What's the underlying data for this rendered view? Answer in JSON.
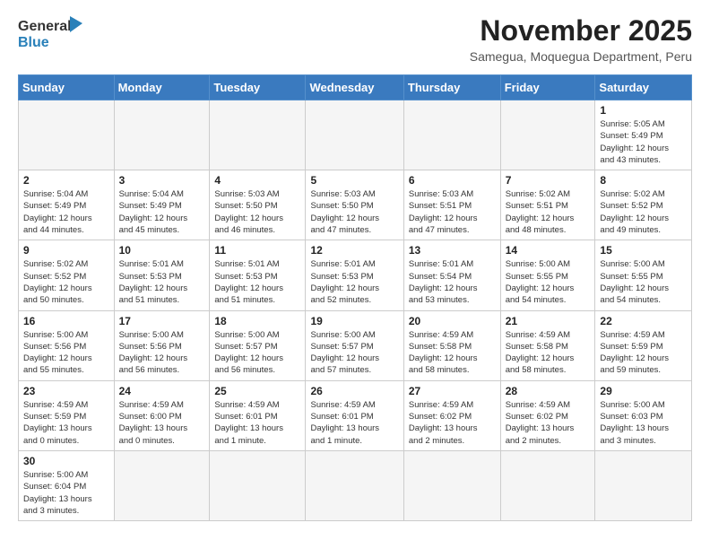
{
  "header": {
    "logo_general": "General",
    "logo_blue": "Blue",
    "month_year": "November 2025",
    "location": "Samegua, Moquegua Department, Peru"
  },
  "days_of_week": [
    "Sunday",
    "Monday",
    "Tuesday",
    "Wednesday",
    "Thursday",
    "Friday",
    "Saturday"
  ],
  "weeks": [
    [
      {
        "day": "",
        "info": ""
      },
      {
        "day": "",
        "info": ""
      },
      {
        "day": "",
        "info": ""
      },
      {
        "day": "",
        "info": ""
      },
      {
        "day": "",
        "info": ""
      },
      {
        "day": "",
        "info": ""
      },
      {
        "day": "1",
        "info": "Sunrise: 5:05 AM\nSunset: 5:49 PM\nDaylight: 12 hours\nand 43 minutes."
      }
    ],
    [
      {
        "day": "2",
        "info": "Sunrise: 5:04 AM\nSunset: 5:49 PM\nDaylight: 12 hours\nand 44 minutes."
      },
      {
        "day": "3",
        "info": "Sunrise: 5:04 AM\nSunset: 5:49 PM\nDaylight: 12 hours\nand 45 minutes."
      },
      {
        "day": "4",
        "info": "Sunrise: 5:03 AM\nSunset: 5:50 PM\nDaylight: 12 hours\nand 46 minutes."
      },
      {
        "day": "5",
        "info": "Sunrise: 5:03 AM\nSunset: 5:50 PM\nDaylight: 12 hours\nand 47 minutes."
      },
      {
        "day": "6",
        "info": "Sunrise: 5:03 AM\nSunset: 5:51 PM\nDaylight: 12 hours\nand 47 minutes."
      },
      {
        "day": "7",
        "info": "Sunrise: 5:02 AM\nSunset: 5:51 PM\nDaylight: 12 hours\nand 48 minutes."
      },
      {
        "day": "8",
        "info": "Sunrise: 5:02 AM\nSunset: 5:52 PM\nDaylight: 12 hours\nand 49 minutes."
      }
    ],
    [
      {
        "day": "9",
        "info": "Sunrise: 5:02 AM\nSunset: 5:52 PM\nDaylight: 12 hours\nand 50 minutes."
      },
      {
        "day": "10",
        "info": "Sunrise: 5:01 AM\nSunset: 5:53 PM\nDaylight: 12 hours\nand 51 minutes."
      },
      {
        "day": "11",
        "info": "Sunrise: 5:01 AM\nSunset: 5:53 PM\nDaylight: 12 hours\nand 51 minutes."
      },
      {
        "day": "12",
        "info": "Sunrise: 5:01 AM\nSunset: 5:53 PM\nDaylight: 12 hours\nand 52 minutes."
      },
      {
        "day": "13",
        "info": "Sunrise: 5:01 AM\nSunset: 5:54 PM\nDaylight: 12 hours\nand 53 minutes."
      },
      {
        "day": "14",
        "info": "Sunrise: 5:00 AM\nSunset: 5:55 PM\nDaylight: 12 hours\nand 54 minutes."
      },
      {
        "day": "15",
        "info": "Sunrise: 5:00 AM\nSunset: 5:55 PM\nDaylight: 12 hours\nand 54 minutes."
      }
    ],
    [
      {
        "day": "16",
        "info": "Sunrise: 5:00 AM\nSunset: 5:56 PM\nDaylight: 12 hours\nand 55 minutes."
      },
      {
        "day": "17",
        "info": "Sunrise: 5:00 AM\nSunset: 5:56 PM\nDaylight: 12 hours\nand 56 minutes."
      },
      {
        "day": "18",
        "info": "Sunrise: 5:00 AM\nSunset: 5:57 PM\nDaylight: 12 hours\nand 56 minutes."
      },
      {
        "day": "19",
        "info": "Sunrise: 5:00 AM\nSunset: 5:57 PM\nDaylight: 12 hours\nand 57 minutes."
      },
      {
        "day": "20",
        "info": "Sunrise: 4:59 AM\nSunset: 5:58 PM\nDaylight: 12 hours\nand 58 minutes."
      },
      {
        "day": "21",
        "info": "Sunrise: 4:59 AM\nSunset: 5:58 PM\nDaylight: 12 hours\nand 58 minutes."
      },
      {
        "day": "22",
        "info": "Sunrise: 4:59 AM\nSunset: 5:59 PM\nDaylight: 12 hours\nand 59 minutes."
      }
    ],
    [
      {
        "day": "23",
        "info": "Sunrise: 4:59 AM\nSunset: 5:59 PM\nDaylight: 13 hours\nand 0 minutes."
      },
      {
        "day": "24",
        "info": "Sunrise: 4:59 AM\nSunset: 6:00 PM\nDaylight: 13 hours\nand 0 minutes."
      },
      {
        "day": "25",
        "info": "Sunrise: 4:59 AM\nSunset: 6:01 PM\nDaylight: 13 hours\nand 1 minute."
      },
      {
        "day": "26",
        "info": "Sunrise: 4:59 AM\nSunset: 6:01 PM\nDaylight: 13 hours\nand 1 minute."
      },
      {
        "day": "27",
        "info": "Sunrise: 4:59 AM\nSunset: 6:02 PM\nDaylight: 13 hours\nand 2 minutes."
      },
      {
        "day": "28",
        "info": "Sunrise: 4:59 AM\nSunset: 6:02 PM\nDaylight: 13 hours\nand 2 minutes."
      },
      {
        "day": "29",
        "info": "Sunrise: 5:00 AM\nSunset: 6:03 PM\nDaylight: 13 hours\nand 3 minutes."
      }
    ],
    [
      {
        "day": "30",
        "info": "Sunrise: 5:00 AM\nSunset: 6:04 PM\nDaylight: 13 hours\nand 3 minutes."
      },
      {
        "day": "",
        "info": ""
      },
      {
        "day": "",
        "info": ""
      },
      {
        "day": "",
        "info": ""
      },
      {
        "day": "",
        "info": ""
      },
      {
        "day": "",
        "info": ""
      },
      {
        "day": "",
        "info": ""
      }
    ]
  ]
}
